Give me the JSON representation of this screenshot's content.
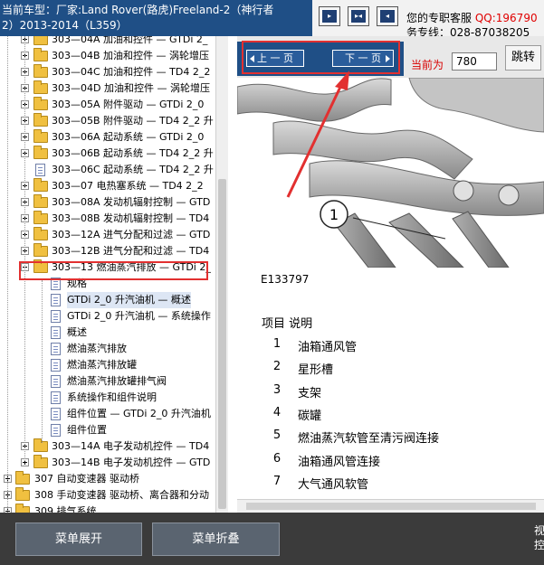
{
  "header": {
    "vehicle_line1": "当前车型：厂家:Land Rover(路虎)Freeland-2（神行者",
    "vehicle_line2": "2）2013-2014（L359）",
    "nav_buttons": [
      "first",
      "middle",
      "last"
    ],
    "service_prefix": "您的专职客服",
    "service_qq": "QQ:196790",
    "service_hotline": "务专线：028-87038205"
  },
  "tree": {
    "items": [
      {
        "label": "303—04A 加油和控件 — GTDi 2_",
        "kind": "folder",
        "expander": "plus"
      },
      {
        "label": "303—04B 加油和控件 — 涡轮增压",
        "kind": "folder",
        "expander": "plus"
      },
      {
        "label": "303—04C 加油和控件 — TD4 2_2",
        "kind": "folder",
        "expander": "plus"
      },
      {
        "label": "303—04D 加油和控件 — 涡轮增压",
        "kind": "folder",
        "expander": "plus"
      },
      {
        "label": "303—05A 附件驱动 — GTDi 2_0",
        "kind": "folder",
        "expander": "plus"
      },
      {
        "label": "303—05B 附件驱动 — TD4 2_2 升",
        "kind": "folder",
        "expander": "plus"
      },
      {
        "label": "303—06A 起动系统 — GTDi 2_0",
        "kind": "folder",
        "expander": "plus"
      },
      {
        "label": "303—06B 起动系统 — TD4 2_2 升",
        "kind": "folder",
        "expander": "plus"
      },
      {
        "label": "303—06C 起动系统 — TD4 2_2 升",
        "kind": "doc",
        "expander": "none"
      },
      {
        "label": "303—07 电热塞系统 — TD4 2_2 ",
        "kind": "folder",
        "expander": "plus"
      },
      {
        "label": "303—08A 发动机辐射控制 — GTD",
        "kind": "folder",
        "expander": "plus"
      },
      {
        "label": "303—08B 发动机辐射控制 — TD4",
        "kind": "folder",
        "expander": "plus"
      },
      {
        "label": "303—12A 进气分配和过滤 — GTD",
        "kind": "folder",
        "expander": "plus"
      },
      {
        "label": "303—12B 进气分配和过滤 — TD4",
        "kind": "folder",
        "expander": "plus"
      },
      {
        "label": "303—13 燃油蒸汽排放 — GTDi 2_",
        "kind": "folder-open",
        "expander": "minus"
      },
      {
        "label": "规格",
        "kind": "doc",
        "expander": "none"
      },
      {
        "label": "GTDi 2_0 升汽油机 — 概述",
        "kind": "doc",
        "expander": "none",
        "selected": true
      },
      {
        "label": "GTDi 2_0 升汽油机 — 系统操作",
        "kind": "doc",
        "expander": "none"
      },
      {
        "label": "概述",
        "kind": "doc",
        "expander": "none"
      },
      {
        "label": "燃油蒸汽排放",
        "kind": "doc",
        "expander": "none"
      },
      {
        "label": "燃油蒸汽排放罐",
        "kind": "doc",
        "expander": "none"
      },
      {
        "label": "燃油蒸汽排放罐排气阀",
        "kind": "doc",
        "expander": "none"
      },
      {
        "label": "系统操作和组件说明",
        "kind": "doc",
        "expander": "none"
      },
      {
        "label": "组件位置 — GTDi 2_0 升汽油机",
        "kind": "doc",
        "expander": "none"
      },
      {
        "label": "组件位置",
        "kind": "doc",
        "expander": "none"
      },
      {
        "label": "303—14A 电子发动机控件 — TD4",
        "kind": "folder",
        "expander": "plus"
      },
      {
        "label": "303—14B 电子发动机控件 — GTD",
        "kind": "folder",
        "expander": "plus"
      },
      {
        "label": "307 自动变速器 驱动桥",
        "kind": "folder",
        "expander": "plus"
      },
      {
        "label": "308 手动变速器 驱动桥、离合器和分动",
        "kind": "folder",
        "expander": "plus"
      },
      {
        "label": "309 排气系统",
        "kind": "folder",
        "expander": "plus"
      }
    ]
  },
  "pager": {
    "prev_label": "上 一 页",
    "next_label": "下 一 页",
    "current_label": "当前为",
    "current_value": "780",
    "jump_label": "跳转"
  },
  "document": {
    "callout": "1",
    "figure_code": "E133797",
    "legend_head": "项目  说明",
    "items": [
      {
        "n": "1",
        "text": "油箱通风管"
      },
      {
        "n": "2",
        "text": "星形槽"
      },
      {
        "n": "3",
        "text": "支架"
      },
      {
        "n": "4",
        "text": "碳罐"
      },
      {
        "n": "5",
        "text": "燃油蒸汽软管至清污阀连接"
      },
      {
        "n": "6",
        "text": "油箱通风管连接"
      },
      {
        "n": "7",
        "text": "大气通风软管"
      }
    ]
  },
  "bottom": {
    "expand_label": "菜单展开",
    "collapse_label": "菜单折叠",
    "right_line1": "视",
    "right_line2": "控"
  },
  "colors": {
    "header_blue": "#1f4f86",
    "highlight_red": "#e23030",
    "qq_red": "#e00000",
    "bottom_bar": "#3b3b3b"
  }
}
